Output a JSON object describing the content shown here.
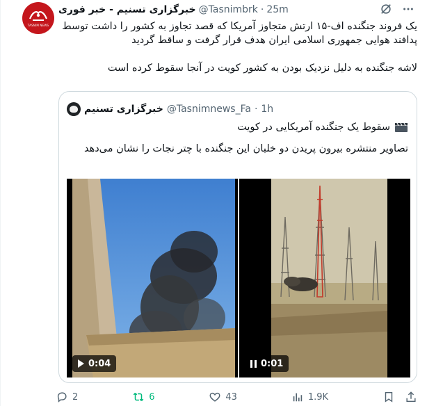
{
  "tweet": {
    "author_name": "خبرگزاری تسنیم - خبر فوری",
    "handle": "@Tasnimbrk",
    "separator": "·",
    "time": "25m",
    "avatar_icon": "tasnim-logo",
    "lines": [
      "یک فروند جنگنده اف-۱۵ ارتش متجاوز آمریکا که قصد تجاوز به کشور را داشت توسط",
      "پدافند هوایی جمهوری اسلامی ایران هدف قرار گرفت و ساقط گردید",
      "لاشه جنگنده به دلیل نزدیک بودن به کشور کویت در آنجا سقوط کرده است"
    ]
  },
  "quote": {
    "author_name": "خبرگزاری تسنیم",
    "handle": "@Tasnimnews_Fa",
    "separator": "·",
    "time": "1h",
    "headline": "سقوط یک جنگنده آمریکایی در کویت",
    "headline_icon": "clapperboard-icon",
    "body": "تصاویر منتشره بیرون پریدن دو خلبان این جنگنده با چتر نجات را نشان می‌دهد",
    "videos": [
      {
        "state": "play",
        "duration": "0:04",
        "scene": "sky-smoke"
      },
      {
        "state": "pause",
        "duration": "0:01",
        "scene": "desert-towers"
      }
    ]
  },
  "actions": {
    "replies": "2",
    "reposts": "6",
    "likes": "43",
    "views": "1.9K"
  },
  "colors": {
    "text": "#0f1419",
    "muted": "#536471",
    "border": "#cfd9de",
    "repost_active": "#00ba7c",
    "avatar_red": "#c4161c"
  }
}
